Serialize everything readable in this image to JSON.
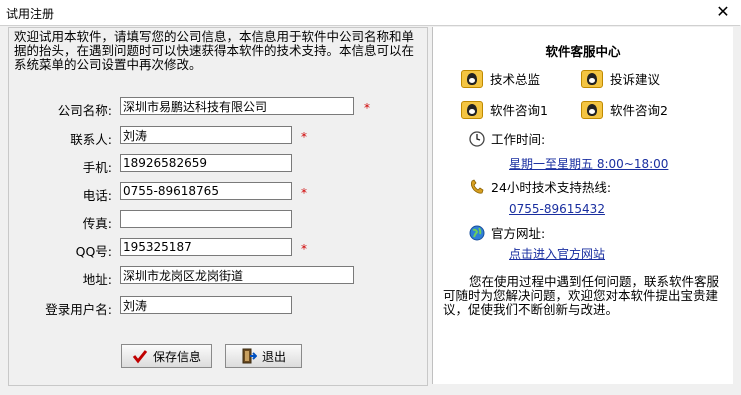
{
  "window": {
    "title": "试用注册",
    "close_symbol": "✕"
  },
  "intro": "欢迎试用本软件，请填写您的公司信息，本信息用于软件中公司名称和单据的抬头，在遇到问题时可以快速获得本软件的技术支持。本信息可以在系统菜单的公司设置中再次修改。",
  "form": {
    "company_label": "公司名称:",
    "company_value": "深圳市易鹏达科技有限公司",
    "contact_label": "联系人:",
    "contact_value": "刘涛",
    "mobile_label": "手机:",
    "mobile_value": "18926582659",
    "phone_label": "电话:",
    "phone_value": "0755-89618765",
    "fax_label": "传真:",
    "fax_value": "",
    "qq_label": "QQ号:",
    "qq_value": "195325187",
    "address_label": "地址:",
    "address_value": "深圳市龙岗区龙岗街道",
    "login_label": "登录用户名:",
    "login_value": "刘涛",
    "required_mark": "*"
  },
  "buttons": {
    "save": "保存信息",
    "exit": "退出"
  },
  "service": {
    "title": "软件客服中心",
    "qq_links": [
      "技术总监",
      "投诉建议",
      "软件咨询1",
      "软件咨询2"
    ],
    "work_time_label": "工作时间:",
    "work_time_value": "星期一至星期五  8:00~18:00",
    "hotline_label": "24小时技术支持热线:",
    "hotline_value": "0755-89615432",
    "website_label": "官方网址:",
    "website_link": "点击进入官方网站",
    "footer": "您在使用过程中遇到任何问题，联系软件客服可随时为您解决问题，欢迎您对本软件提出宝贵建议，促使我们不断创新与改进。"
  },
  "colors": {
    "link": "#1a2fa0",
    "required": "#d00000",
    "qq_yellow": "#f4c542"
  }
}
